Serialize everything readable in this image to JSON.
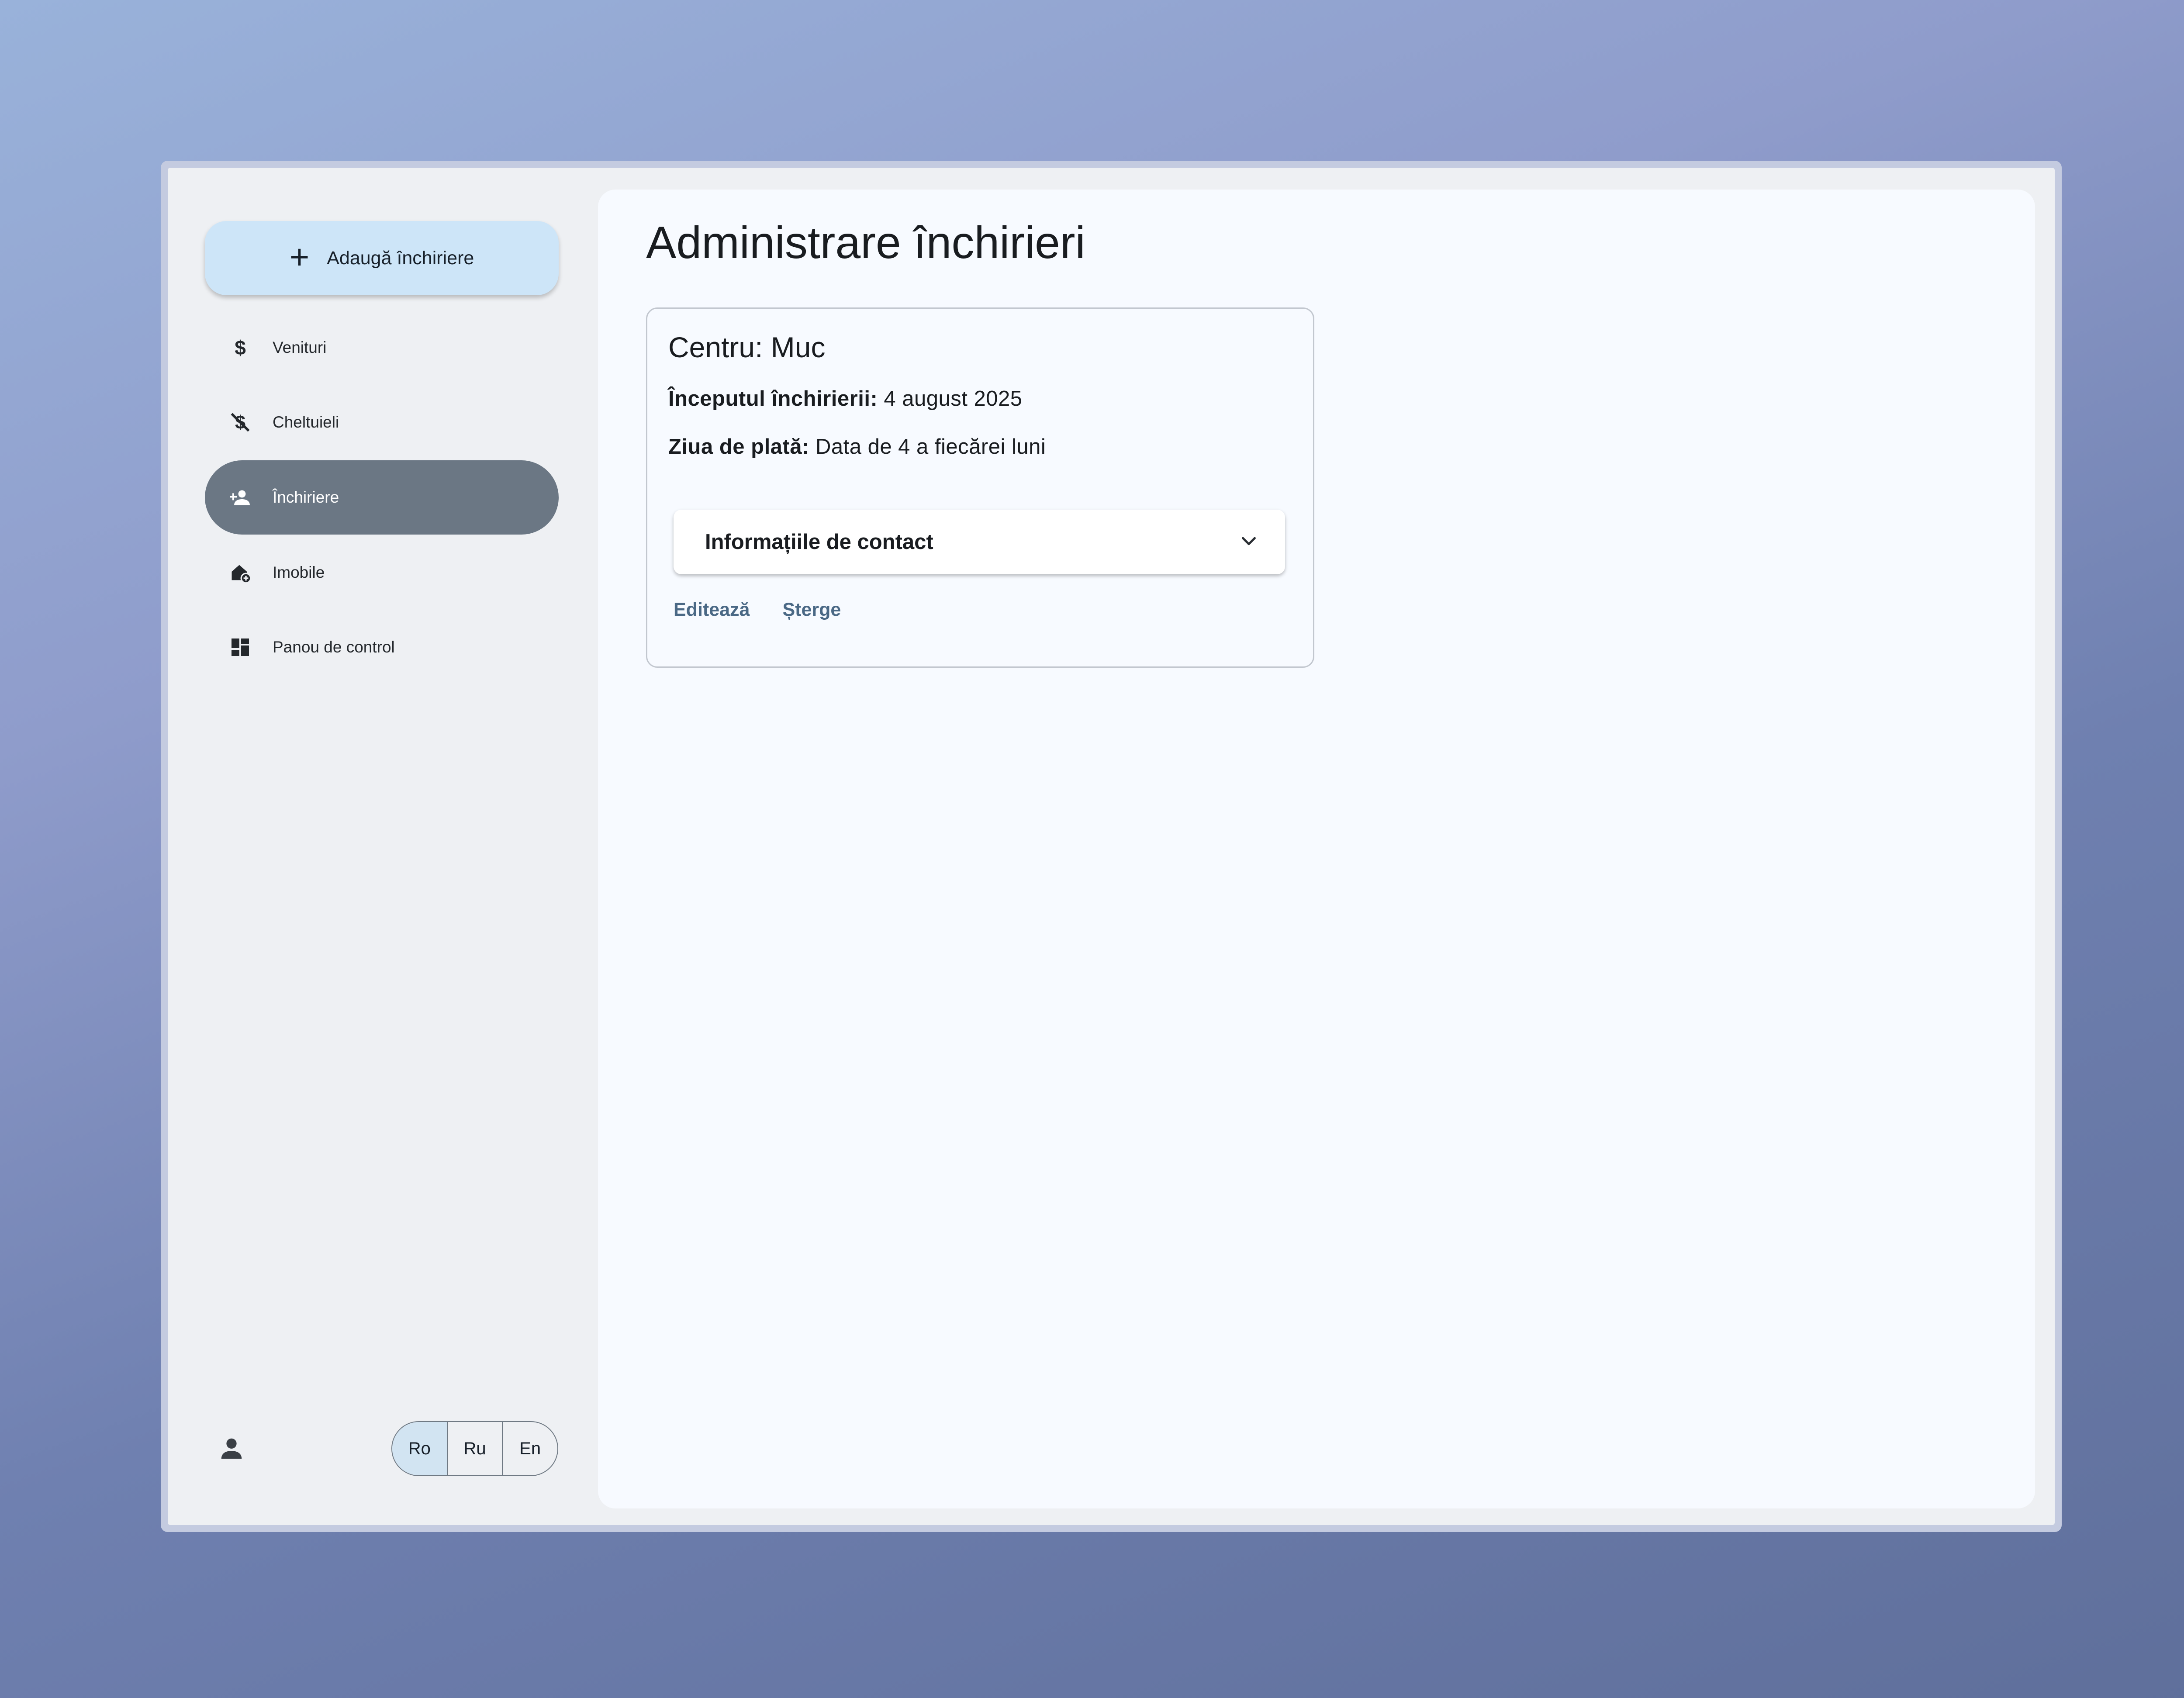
{
  "sidebar": {
    "add_button": {
      "icon": "plus-icon",
      "label": "Adaugă închiriere"
    },
    "items": [
      {
        "icon": "dollar-icon",
        "label": "Venituri",
        "active": false
      },
      {
        "icon": "money-off-icon",
        "label": "Cheltuieli",
        "active": false
      },
      {
        "icon": "person-add-icon",
        "label": "Închiriere",
        "active": true
      },
      {
        "icon": "home-add-icon",
        "label": "Imobile",
        "active": false
      },
      {
        "icon": "dashboard-icon",
        "label": "Panou de control",
        "active": false
      }
    ],
    "user_icon": "person-icon",
    "languages": [
      {
        "label": "Ro",
        "active": true
      },
      {
        "label": "Ru",
        "active": false
      },
      {
        "label": "En",
        "active": false
      }
    ]
  },
  "main": {
    "title": "Administrare închirieri",
    "card": {
      "title": "Centru: Muc",
      "start_label": "Începutul închirierii:",
      "start_value": "4 august 2025",
      "pay_label": "Ziua de plată:",
      "pay_value": "Data de 4 a fiecărei luni",
      "accordion_label": "Informațiile de contact",
      "accordion_icon": "chevron-down-icon",
      "edit_label": "Editează",
      "delete_label": "Șterge"
    }
  },
  "colors": {
    "active_nav": "#6b7784",
    "add_button": "#cde5f8",
    "link": "#4a6885",
    "lang_active": "#d2e4f2"
  }
}
